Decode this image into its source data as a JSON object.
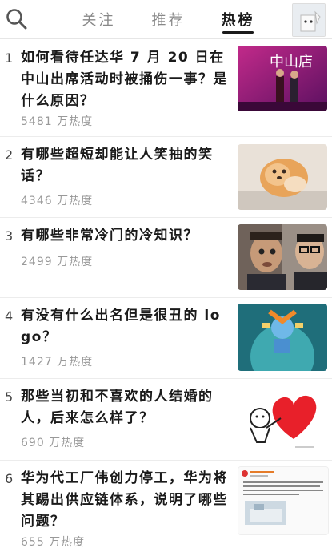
{
  "header": {
    "tabs": [
      {
        "label": "关注"
      },
      {
        "label": "推荐"
      },
      {
        "label": "热榜"
      }
    ],
    "active_tab": "热榜"
  },
  "items": [
    {
      "rank": "1",
      "title": "如何看待任达华 7 月 20 日在中山出席活动时被捅伤一事？是什么原因？",
      "heat": "5481 万热度",
      "thumb_text": "中山店"
    },
    {
      "rank": "2",
      "title": "有哪些超短却能让人笑抽的笑话？",
      "heat": "4346 万热度"
    },
    {
      "rank": "3",
      "title": "有哪些非常冷门的冷知识？",
      "heat": "2499 万热度"
    },
    {
      "rank": "4",
      "title": "有没有什么出名但是很丑的 logo？",
      "heat": "1427 万热度"
    },
    {
      "rank": "5",
      "title": "那些当初和不喜欢的人结婚的人，后来怎么样了？",
      "heat": "690 万热度"
    },
    {
      "rank": "6",
      "title": "华为代工厂伟创力停工，华为将其踢出供应链体系，说明了哪些问题？",
      "heat": "655 万热度"
    }
  ]
}
